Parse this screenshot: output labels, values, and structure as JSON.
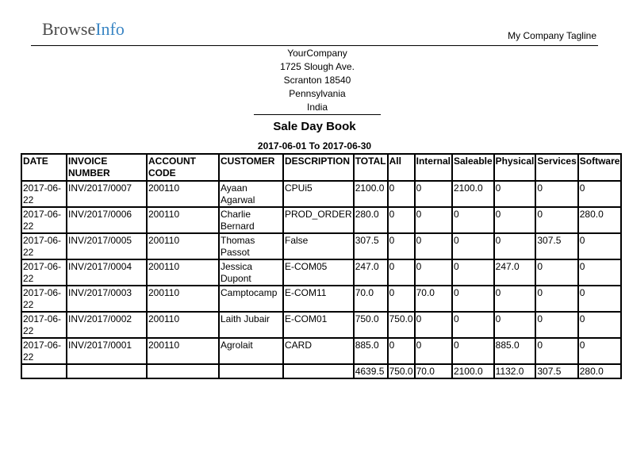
{
  "header": {
    "logo_part1": "Browse",
    "logo_part2": "Info",
    "tagline": "My Company Tagline"
  },
  "company": {
    "name": "YourCompany",
    "street": "1725 Slough Ave.",
    "city_zip": "Scranton 18540",
    "state": "Pennsylvania",
    "country": "India"
  },
  "report": {
    "title": "Sale Day Book",
    "period": "2017-06-01 To 2017-06-30"
  },
  "table": {
    "columns": [
      "DATE",
      "INVOICE NUMBER",
      "ACCOUNT CODE",
      "CUSTOMER",
      "DESCRIPTION",
      "TOTAL",
      "All",
      "Internal",
      "Saleable",
      "Physical",
      "Services",
      "Software"
    ],
    "rows": [
      [
        "2017-06-22",
        "INV/2017/0007",
        "200110",
        "Ayaan Agarwal",
        "CPUi5",
        "2100.0",
        "0",
        "0",
        "2100.0",
        "0",
        "0",
        "0"
      ],
      [
        "2017-06-22",
        "INV/2017/0006",
        "200110",
        "Charlie Bernard",
        "PROD_ORDER",
        "280.0",
        "0",
        "0",
        "0",
        "0",
        "0",
        "280.0"
      ],
      [
        "2017-06-22",
        "INV/2017/0005",
        "200110",
        "Thomas Passot",
        "False",
        "307.5",
        "0",
        "0",
        "0",
        "0",
        "307.5",
        "0"
      ],
      [
        "2017-06-22",
        "INV/2017/0004",
        "200110",
        "Jessica Dupont",
        "E-COM05",
        "247.0",
        "0",
        "0",
        "0",
        "247.0",
        "0",
        "0"
      ],
      [
        "2017-06-22",
        "INV/2017/0003",
        "200110",
        "Camptocamp",
        "E-COM11",
        "70.0",
        "0",
        "70.0",
        "0",
        "0",
        "0",
        "0"
      ],
      [
        "2017-06-22",
        "INV/2017/0002",
        "200110",
        "Laith Jubair",
        "E-COM01",
        "750.0",
        "750.0",
        "0",
        "0",
        "0",
        "0",
        "0"
      ],
      [
        "2017-06-22",
        "INV/2017/0001",
        "200110",
        "Agrolait",
        "CARD",
        "885.0",
        "0",
        "0",
        "0",
        "885.0",
        "0",
        "0"
      ]
    ],
    "totals": [
      "",
      "",
      "",
      "",
      "",
      "4639.5",
      "750.0",
      "70.0",
      "2100.0",
      "1132.0",
      "307.5",
      "280.0"
    ]
  }
}
